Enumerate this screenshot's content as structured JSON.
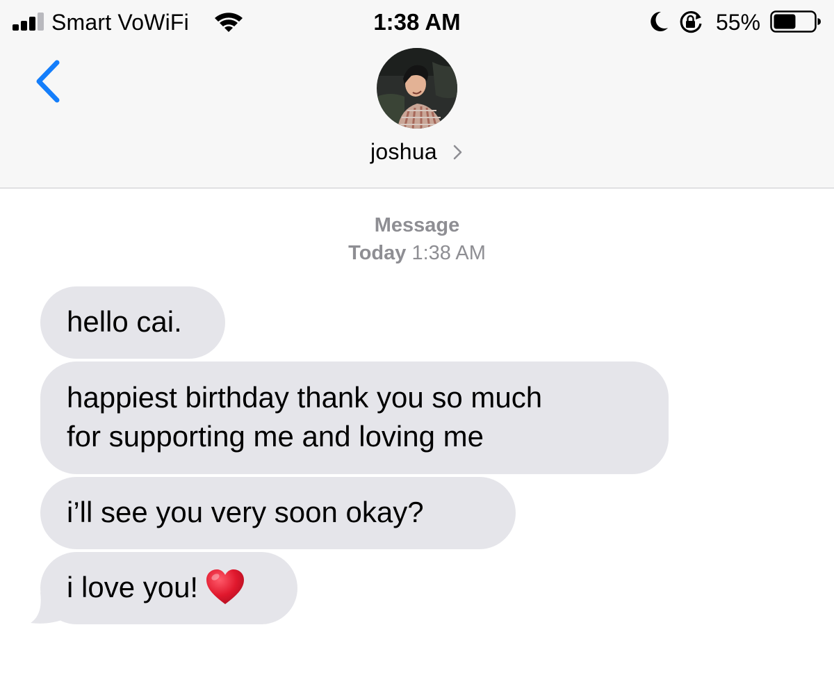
{
  "status_bar": {
    "carrier": "Smart VoWiFi",
    "time": "1:38 AM",
    "battery_percent": "55%",
    "battery_level": 0.55,
    "signal_bars_filled": 3,
    "signal_bars_total": 4,
    "icons": [
      "signal-icon",
      "wifi-icon",
      "moon-icon",
      "lock-rotation-icon",
      "battery-icon"
    ]
  },
  "nav": {
    "back_icon": "chevron-left-icon",
    "contact_name": "joshua",
    "contact_chevron_icon": "chevron-right-icon"
  },
  "conversation": {
    "service": "Message",
    "day": "Today",
    "time": "1:38 AM",
    "messages": [
      {
        "text": "hello cai."
      },
      {
        "line1": "happiest birthday thank you so much",
        "line2": "for supporting me and loving me"
      },
      {
        "text": "i’ll see you very soon okay?"
      },
      {
        "text": "i love you!",
        "emoji": "heart-icon"
      }
    ]
  },
  "colors": {
    "accent": "#147efb",
    "bubble_received": "#e5e5ea",
    "header_bg": "#f7f7f7",
    "meta_text": "#8e8e93",
    "heart": "#e0182d"
  }
}
